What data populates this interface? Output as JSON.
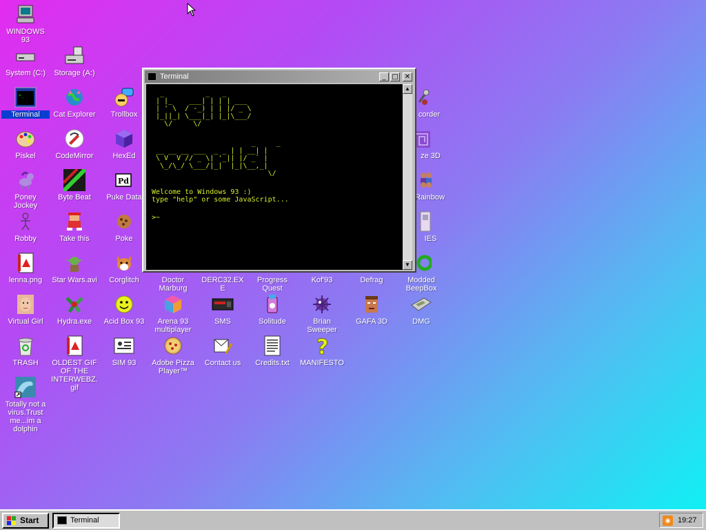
{
  "desktop": {
    "icons": [
      {
        "label": "WINDOWS 93",
        "icon": "computer-icon"
      },
      {
        "label": "System (C:)",
        "icon": "drive-icon"
      },
      {
        "label": "Storage (A:)",
        "icon": "floppy-drive-icon"
      },
      {
        "label": "Terminal",
        "icon": "terminal-icon",
        "selected": true
      },
      {
        "label": "Cat Explorer",
        "icon": "cat-globe-icon"
      },
      {
        "label": "Trollbox",
        "icon": "chat-face-icon"
      },
      {
        "label": "Piskel",
        "icon": "palette-icon"
      },
      {
        "label": "CodeMirror",
        "icon": "editor-icon"
      },
      {
        "label": "HexEd",
        "icon": "hex-cube-icon"
      },
      {
        "label": "Poney Jockey",
        "icon": "pony-icon"
      },
      {
        "label": "Byte Beat",
        "icon": "bytebeat-icon"
      },
      {
        "label": "Puke Data",
        "icon": "pd-icon"
      },
      {
        "label": "Robby",
        "icon": "stick-figure-icon"
      },
      {
        "label": "Take this",
        "icon": "creature-icon"
      },
      {
        "label": "Poke",
        "icon": "cookie-icon"
      },
      {
        "label": "lenna.png",
        "icon": "image-file-icon"
      },
      {
        "label": "Star Wars.avi",
        "icon": "yoda-icon"
      },
      {
        "label": "Corglitch",
        "icon": "corgi-icon"
      },
      {
        "label": "Doctor Marburg",
        "icon": "doctor-icon"
      },
      {
        "label": "DERC32.EXE",
        "icon": "exe-icon"
      },
      {
        "label": "Progress Quest",
        "icon": "progress-quest-icon"
      },
      {
        "label": "Kof'93",
        "icon": "kof-icon"
      },
      {
        "label": "Defrag",
        "icon": "defrag-icon"
      },
      {
        "label": "Modded BeepBox",
        "icon": "beepbox-icon"
      },
      {
        "label": "Virtual Girl",
        "icon": "face-icon"
      },
      {
        "label": "Hydra.exe",
        "icon": "hydra-icon"
      },
      {
        "label": "Acid Box 93",
        "icon": "smiley-icon"
      },
      {
        "label": "Arena 93 multiplayer",
        "icon": "cube-icon"
      },
      {
        "label": "SMS",
        "icon": "console-icon"
      },
      {
        "label": "Solitude",
        "icon": "solitude-icon"
      },
      {
        "label": "Brian Sweeper",
        "icon": "mine-icon"
      },
      {
        "label": "GAFA 3D",
        "icon": "doomguy-icon"
      },
      {
        "label": "DMG",
        "icon": "gameboy-icon"
      },
      {
        "label": "TRASH",
        "icon": "recycle-bin-icon"
      },
      {
        "label": "OLDEST GIF OF THE INTERWEBZ.gif",
        "icon": "gif-file-icon"
      },
      {
        "label": "SIM 93",
        "icon": "sim-icon"
      },
      {
        "label": "Adobe Pizza Player™",
        "icon": "pizza-icon"
      },
      {
        "label": "Contact us",
        "icon": "contact-icon"
      },
      {
        "label": "Credits.txt",
        "icon": "text-file-icon"
      },
      {
        "label": "MANIFESTO",
        "icon": "question-mark-icon"
      },
      {
        "label": "Totally not a virus.Trust me...im a dolphin",
        "icon": "dolphin-icon"
      },
      {
        "label": "corder",
        "icon": "recorder-icon"
      },
      {
        "label": "ze 3D",
        "icon": "maze-icon"
      },
      {
        "label": "Rainbow",
        "icon": "rainbow-icon"
      },
      {
        "label": "IES",
        "icon": "ies-icon"
      }
    ]
  },
  "terminal": {
    "title": "Terminal",
    "ascii_hello": [
      "  _          _   _",
      " | |_    ___| | | | ___",
      " | ' \\  / -_) | | |/ _ \\",
      " |_||_| \\___|_| |_|\\___/",
      "   \\/     \\/"
    ],
    "ascii_world": [
      "                        _     _",
      " __ __ __ ___  _ _ | | __| |",
      " \\ V  V // _ \\| '_|| |/ _` |",
      "  \\_/\\_/ \\___/|_|  |_|\\__,_|",
      "                            \\/"
    ],
    "welcome": "Welcome to Windows 93 :)",
    "hint": "type \"help\" or some JavaScript...",
    "prompt": ">~",
    "buttons": {
      "minimize": "_",
      "maximize": "□",
      "close": "✕"
    }
  },
  "taskbar": {
    "start_label": "Start",
    "tasks": [
      {
        "label": "Terminal",
        "icon": "terminal-icon"
      }
    ],
    "tray": {
      "icon": "rss-icon",
      "clock": "19:27"
    }
  }
}
